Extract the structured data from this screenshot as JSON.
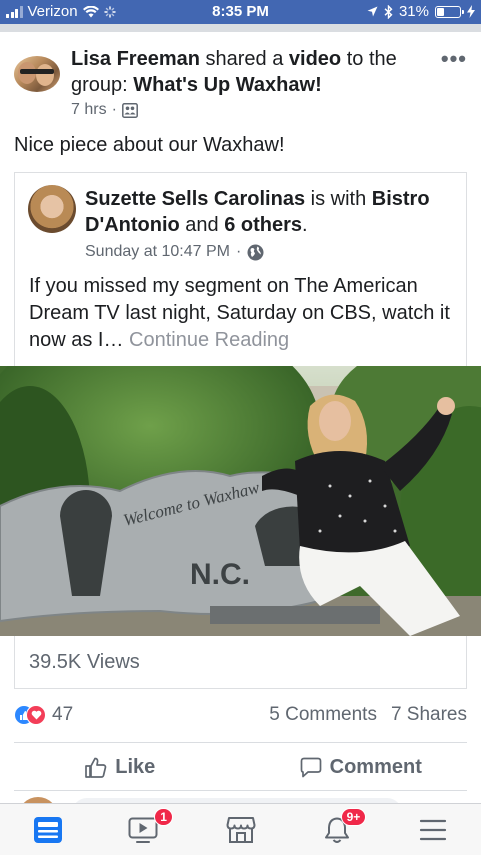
{
  "status_bar": {
    "carrier": "Verizon",
    "time": "8:35 PM",
    "battery": "31%",
    "battery_level": 0.31
  },
  "post": {
    "author": "Lisa Freeman",
    "action_text": " shared a ",
    "object_text": "video",
    "to_text": " to the group: ",
    "group": "What's Up Waxhaw!",
    "time": "7 hrs",
    "privacy_icon": "group-members-icon",
    "more_icon": "more-options-icon",
    "text": "Nice piece about our Waxhaw!"
  },
  "shared": {
    "author": "Suzette Sells Carolinas",
    "with_text": " is with ",
    "place": "Bistro D'Antonio",
    "and_text": " and ",
    "others": "6 others",
    "end_text": ".",
    "time": "Sunday at 10:47 PM",
    "privacy_icon": "globe-icon",
    "body": "If you missed my segment on The American Dream TV last night, Saturday on CBS, watch it now as I…",
    "continue": "Continue Reading",
    "video_sign_line1": "Welcome to Waxhaw",
    "video_sign_line2": "N.C.",
    "views": "39.5K Views"
  },
  "reactions": {
    "count": "47",
    "comments": "5 Comments",
    "shares": "7 Shares"
  },
  "actions": {
    "like": "Like",
    "comment": "Comment"
  },
  "tabbar": {
    "items": [
      {
        "icon": "news-feed-icon",
        "badge": ""
      },
      {
        "icon": "watch-icon",
        "badge": "1"
      },
      {
        "icon": "marketplace-icon",
        "badge": ""
      },
      {
        "icon": "notifications-icon",
        "badge": "9+"
      },
      {
        "icon": "menu-icon",
        "badge": ""
      }
    ]
  },
  "colors": {
    "brand": "#4267b2",
    "tab_active": "#1877f2",
    "badge": "#f02849",
    "like": "#2d88ff",
    "love": "#f33e58"
  }
}
